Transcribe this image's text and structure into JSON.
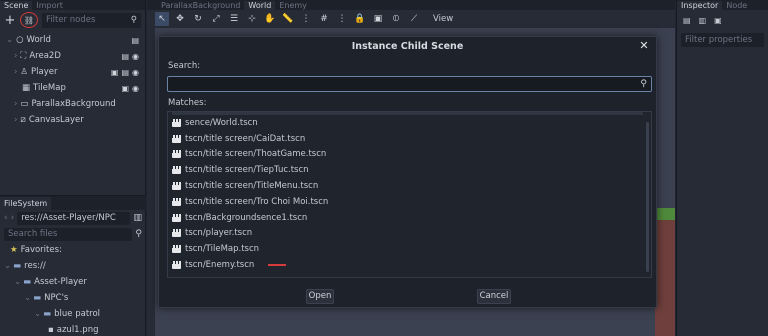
{
  "left_dock": {
    "tabs": [
      "Scene",
      "Import"
    ],
    "filter_placeholder": "Filter nodes",
    "tree": [
      {
        "label": "World"
      },
      {
        "label": "Area2D"
      },
      {
        "label": "Player"
      },
      {
        "label": "TileMap"
      },
      {
        "label": "ParallaxBackground"
      },
      {
        "label": "CanvasLayer"
      }
    ]
  },
  "filesystem": {
    "tab": "FileSystem",
    "path": "res://Asset-Player/NPC",
    "search_placeholder": "Search files",
    "items": [
      {
        "label": "Favorites:"
      },
      {
        "label": "res://"
      },
      {
        "label": "Asset-Player"
      },
      {
        "label": "NPC's"
      },
      {
        "label": "blue patrol"
      },
      {
        "label": "azul1.png"
      }
    ]
  },
  "editor": {
    "tabs": [
      "ParallaxBackground",
      "World",
      "Enemy"
    ],
    "view_menu": "View"
  },
  "inspector": {
    "tabs": [
      "Inspector",
      "Node"
    ],
    "filter_placeholder": "Filter properties"
  },
  "dialog": {
    "title": "Instance Child Scene",
    "search_label": "Search:",
    "search_value": "",
    "matches_label": "Matches:",
    "matches": [
      "sence/World.tscn",
      "tscn/title screen/CaiDat.tscn",
      "tscn/title screen/ThoatGame.tscn",
      "tscn/title screen/TiepTuc.tscn",
      "tscn/title screen/TitleMenu.tscn",
      "tscn/title screen/Tro Choi Moi.tscn",
      "tscn/Backgroundsence1.tscn",
      "tscn/player.tscn",
      "tscn/TileMap.tscn",
      "tscn/Enemy.tscn"
    ],
    "open_label": "Open",
    "cancel_label": "Cancel"
  },
  "colors": {
    "accent": "#6c83a8",
    "highlight_mark": "#d63a3a"
  }
}
